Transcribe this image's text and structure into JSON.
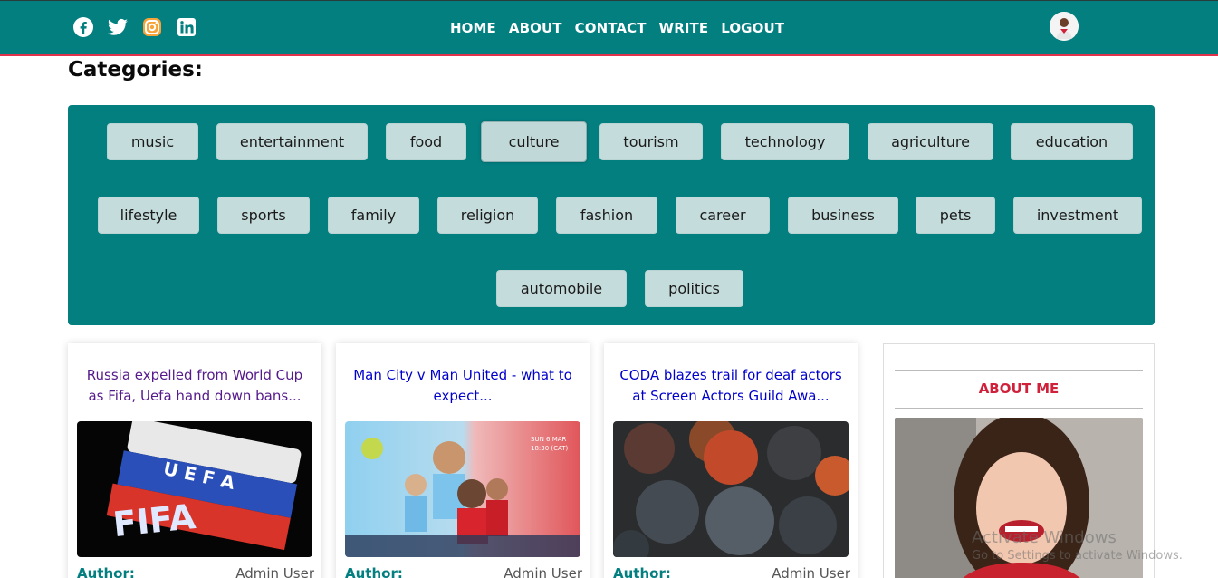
{
  "header": {
    "social": [
      {
        "icon": "facebook-icon",
        "color": "#ffffff"
      },
      {
        "icon": "twitter-icon",
        "color": "#ffffff"
      },
      {
        "icon": "instagram-icon",
        "color": "#f6a33a"
      },
      {
        "icon": "linkedin-icon",
        "color": "#ffffff"
      }
    ],
    "nav": [
      "HOME",
      "ABOUT",
      "CONTACT",
      "WRITE",
      "LOGOUT"
    ],
    "avatar_icon": "user-avatar"
  },
  "categories": {
    "title": "Categories:",
    "selected": "culture",
    "items": [
      "music",
      "entertainment",
      "food",
      "culture",
      "tourism",
      "technology",
      "agriculture",
      "education",
      "lifestyle",
      "sports",
      "family",
      "religion",
      "fashion",
      "career",
      "business",
      "pets",
      "investment",
      "automobile",
      "politics"
    ]
  },
  "posts": [
    {
      "title": "Russia expelled from World Cup as Fifa, Uefa hand down bans...",
      "author_label": "Author:",
      "author": "Admin User",
      "image": "fifa-uefa-flag-image"
    },
    {
      "title": "Man City v Man United - what to expect...",
      "author_label": "Author:",
      "author": "Admin User",
      "image": "man-city-man-united-poster-image"
    },
    {
      "title": "CODA blazes trail for deaf actors at Screen Actors Guild Awa...",
      "author_label": "Author:",
      "author": "Admin User",
      "image": "dark-droplets-image"
    }
  ],
  "sidebar": {
    "heading": "ABOUT ME",
    "image": "smiling-woman-photo"
  },
  "watermark": {
    "line1": "Activate Windows",
    "line2": "Go to Settings to activate Windows."
  },
  "colors": {
    "brand": "#037f80",
    "accent": "#d0213a",
    "chip": "#c5dcdc",
    "link": "#0000cc",
    "visited": "#551a8b"
  }
}
